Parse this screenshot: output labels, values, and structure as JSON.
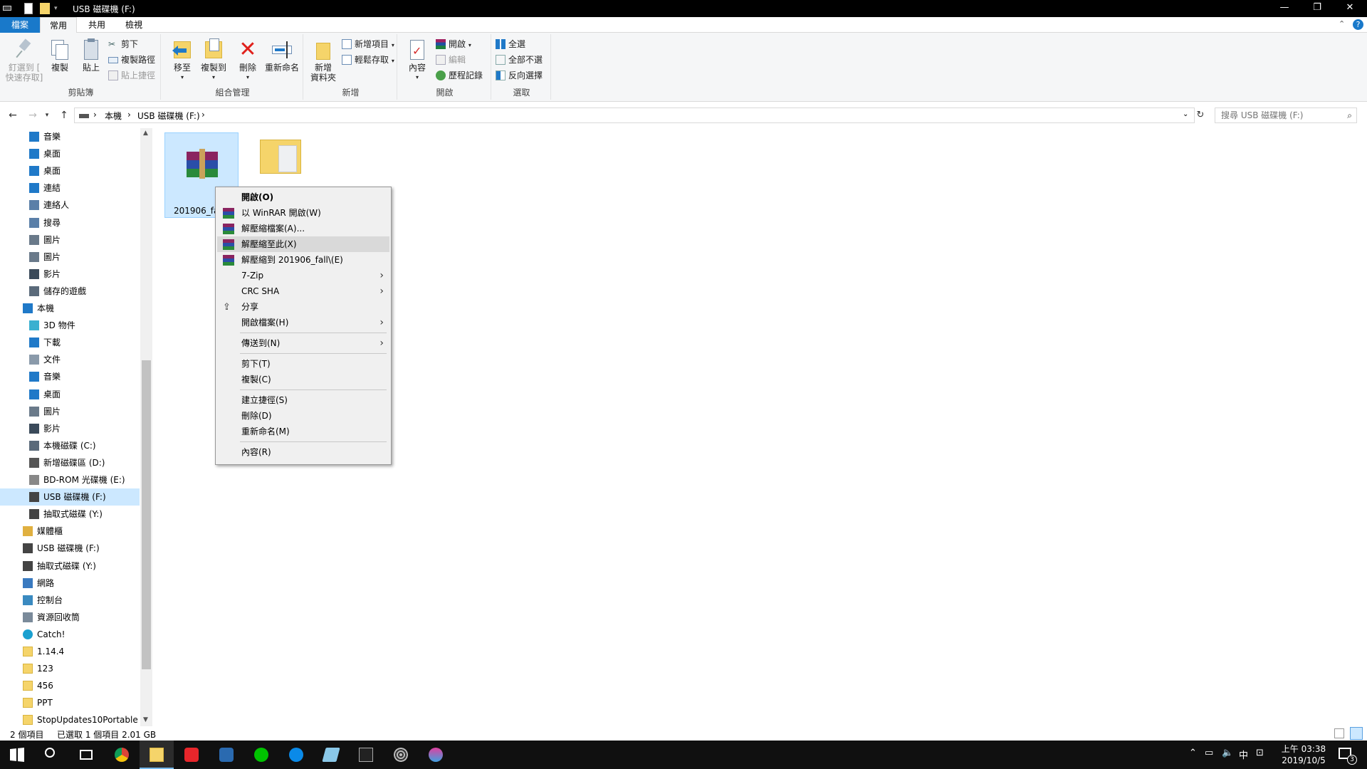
{
  "window": {
    "title": "USB 磁碟機 (F:)",
    "controls": {
      "minimize": "—",
      "restore": "❐",
      "close": "✕"
    }
  },
  "ribbon_tabs": [
    {
      "label": "檔案"
    },
    {
      "label": "常用"
    },
    {
      "label": "共用"
    },
    {
      "label": "檢視"
    }
  ],
  "ribbon": {
    "clipboard": {
      "group_label": "剪貼簿",
      "pin_line1": "釘選到 [",
      "pin_line2": "快速存取]",
      "copy": "複製",
      "paste": "貼上",
      "cut": "剪下",
      "copy_path": "複製路徑",
      "paste_shortcut": "貼上捷徑"
    },
    "organize": {
      "group_label": "組合管理",
      "move_to": "移至",
      "copy_to": "複製到",
      "delete": "刪除",
      "rename": "重新命名"
    },
    "new": {
      "group_label": "新增",
      "new_folder_line1": "新增",
      "new_folder_line2": "資料夾",
      "new_item": "新增項目",
      "easy_access": "輕鬆存取"
    },
    "open": {
      "group_label": "開啟",
      "properties": "內容",
      "open": "開啟",
      "edit": "編輯",
      "history": "歷程記錄"
    },
    "select": {
      "group_label": "選取",
      "select_all": "全選",
      "select_none": "全部不選",
      "invert": "反向選擇"
    }
  },
  "address": {
    "crumbs": [
      "本機",
      "USB 磁碟機 (F:)"
    ],
    "search_placeholder": "搜尋 USB 磁碟機 (F:)"
  },
  "nav_items": [
    {
      "label": "音樂",
      "icon": "music-icon",
      "indent": 2
    },
    {
      "label": "桌面",
      "icon": "desktop-icon",
      "indent": 2
    },
    {
      "label": "桌面",
      "icon": "desktop-icon",
      "indent": 2
    },
    {
      "label": "連結",
      "icon": "link-icon",
      "indent": 2
    },
    {
      "label": "連絡人",
      "icon": "contacts-icon",
      "indent": 2
    },
    {
      "label": "搜尋",
      "icon": "search-icon",
      "indent": 2
    },
    {
      "label": "圖片",
      "icon": "pictures-icon",
      "indent": 2
    },
    {
      "label": "圖片",
      "icon": "pictures-icon",
      "indent": 2
    },
    {
      "label": "影片",
      "icon": "videos-icon",
      "indent": 2
    },
    {
      "label": "儲存的遊戲",
      "icon": "games-icon",
      "indent": 2
    },
    {
      "label": "本機",
      "icon": "computer-icon",
      "indent": 1
    },
    {
      "label": "3D 物件",
      "icon": "3d-objects-icon",
      "indent": 2
    },
    {
      "label": "下載",
      "icon": "download-icon",
      "indent": 2
    },
    {
      "label": "文件",
      "icon": "documents-icon",
      "indent": 2
    },
    {
      "label": "音樂",
      "icon": "music-icon",
      "indent": 2
    },
    {
      "label": "桌面",
      "icon": "desktop-icon",
      "indent": 2
    },
    {
      "label": "圖片",
      "icon": "pictures-icon",
      "indent": 2
    },
    {
      "label": "影片",
      "icon": "videos-icon",
      "indent": 2
    },
    {
      "label": "本機磁碟 (C:)",
      "icon": "system-drive-icon",
      "indent": 2
    },
    {
      "label": "新增磁碟區 (D:)",
      "icon": "drive-icon",
      "indent": 2
    },
    {
      "label": "BD-ROM 光碟機 (E:)",
      "icon": "optical-drive-icon",
      "indent": 2
    },
    {
      "label": "USB 磁碟機 (F:)",
      "icon": "usb-drive-icon",
      "indent": 2,
      "selected": true
    },
    {
      "label": "抽取式磁碟 (Y:)",
      "icon": "removable-drive-icon",
      "indent": 2
    },
    {
      "label": "媒體櫃",
      "icon": "libraries-icon",
      "indent": 1
    },
    {
      "label": "USB 磁碟機 (F:)",
      "icon": "usb-drive-icon",
      "indent": 1
    },
    {
      "label": "抽取式磁碟 (Y:)",
      "icon": "removable-drive-icon",
      "indent": 1
    },
    {
      "label": "網路",
      "icon": "network-icon",
      "indent": 1
    },
    {
      "label": "控制台",
      "icon": "control-panel-icon",
      "indent": 1
    },
    {
      "label": "資源回收筒",
      "icon": "recycle-bin-icon",
      "indent": 1
    },
    {
      "label": "Catch!",
      "icon": "catch-icon",
      "indent": 1
    },
    {
      "label": "1.14.4",
      "icon": "folder-icon",
      "indent": 1
    },
    {
      "label": "123",
      "icon": "folder-icon",
      "indent": 1
    },
    {
      "label": "456",
      "icon": "folder-icon",
      "indent": 1
    },
    {
      "label": "PPT",
      "icon": "folder-icon",
      "indent": 1
    },
    {
      "label": "StopUpdates10Portable",
      "icon": "folder-icon",
      "indent": 1
    }
  ],
  "files": [
    {
      "label": "201906_fa",
      "icon": "rar-archive-icon",
      "selected": true
    },
    {
      "label": "",
      "icon": "folder-icon",
      "selected": false
    }
  ],
  "context_menu": [
    {
      "label": "開啟(O)",
      "bold": true,
      "icon": ""
    },
    {
      "label": "以 WinRAR 開啟(W)",
      "icon": "winrar-icon"
    },
    {
      "label": "解壓縮檔案(A)...",
      "icon": "winrar-icon"
    },
    {
      "label": "解壓縮至此(X)",
      "icon": "winrar-icon",
      "hover": true
    },
    {
      "label": "解壓縮到 201906_fall\\(E)",
      "icon": "winrar-icon"
    },
    {
      "label": "7-Zip",
      "submenu": true
    },
    {
      "label": "CRC SHA",
      "submenu": true
    },
    {
      "label": "分享",
      "icon": "share-icon"
    },
    {
      "label": "開啟檔案(H)",
      "submenu": true
    },
    {
      "sep": true
    },
    {
      "label": "傳送到(N)",
      "submenu": true
    },
    {
      "sep": true
    },
    {
      "label": "剪下(T)"
    },
    {
      "label": "複製(C)"
    },
    {
      "sep": true
    },
    {
      "label": "建立捷徑(S)"
    },
    {
      "label": "刪除(D)"
    },
    {
      "label": "重新命名(M)"
    },
    {
      "sep": true
    },
    {
      "label": "內容(R)"
    }
  ],
  "status": {
    "count": "2 個項目",
    "selection": "已選取 1 個項目  2.01 GB"
  },
  "taskbar": {
    "apps": [
      "start-icon",
      "search-icon",
      "task-view-icon",
      "chrome-icon",
      "file-explorer-icon",
      "garena-icon",
      "app-icon",
      "line-icon",
      "messenger-icon",
      "app-icon",
      "terminal-icon",
      "app-icon",
      "paint-icon"
    ],
    "tray": {
      "ime": "中"
    },
    "clock_time": "上午 03:38",
    "clock_date": "2019/10/5",
    "notification_count": "3"
  },
  "colors": {
    "accent": "#1979ca",
    "selection": "#cce8ff",
    "taskbar": "#101010"
  }
}
